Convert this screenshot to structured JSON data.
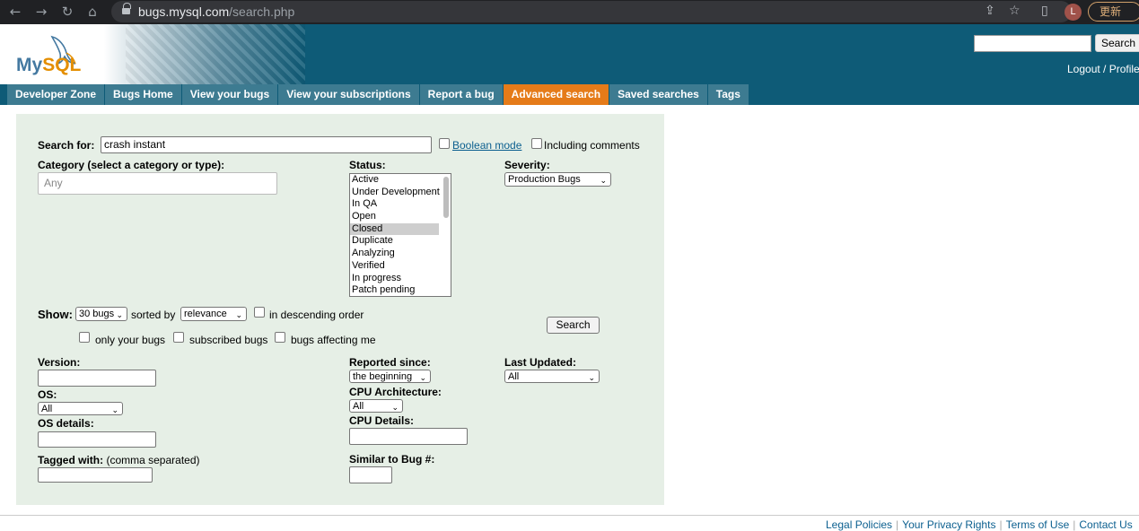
{
  "browser": {
    "url_domain": "bugs.mysql.com",
    "url_path": "/search.php",
    "update_label": "更新",
    "avatar_letter": "L"
  },
  "header": {
    "logo_my": "My",
    "logo_sql": "SQL",
    "search_button": "Search",
    "links": "Logout / Profile"
  },
  "nav": {
    "tabs": [
      "Developer Zone",
      "Bugs Home",
      "View your bugs",
      "View your subscriptions",
      "Report a bug",
      "Advanced search",
      "Saved searches",
      "Tags"
    ],
    "active": "Advanced search"
  },
  "form": {
    "search_for_label": "Search for:",
    "search_for_value": "crash instant",
    "boolean_mode": "Boolean mode",
    "including_comments": "Including comments",
    "category_label": "Category (select a category or type):",
    "category_placeholder": "Any",
    "status_label": "Status:",
    "status_options": [
      "Active",
      "Under Development",
      "In QA",
      "Open",
      "Closed",
      "Duplicate",
      "Analyzing",
      "Verified",
      "In progress",
      "Patch pending"
    ],
    "status_selected": "Closed",
    "severity_label": "Severity:",
    "severity_value": "Production Bugs",
    "show_label": "Show:",
    "show_value": "30 bugs",
    "sorted_by": "sorted by",
    "sort_value": "relevance",
    "descending": "in descending order",
    "search_button": "Search",
    "only_your_bugs": "only your bugs",
    "subscribed_bugs": "subscribed bugs",
    "bugs_affecting_me": "bugs affecting me",
    "version_label": "Version:",
    "reported_since_label": "Reported since:",
    "reported_since_value": "the beginning",
    "last_updated_label": "Last Updated:",
    "last_updated_value": "All",
    "os_label": "OS:",
    "os_value": "All",
    "cpu_arch_label": "CPU Architecture:",
    "cpu_arch_value": "All",
    "os_details_label": "OS details:",
    "cpu_details_label": "CPU Details:",
    "tagged_with_label": "Tagged with:",
    "tagged_with_hint": "(comma separated)",
    "similar_label": "Similar to Bug #:"
  },
  "footer": {
    "links": [
      "Legal Policies",
      "Your Privacy Rights",
      "Terms of Use",
      "Contact Us"
    ]
  }
}
